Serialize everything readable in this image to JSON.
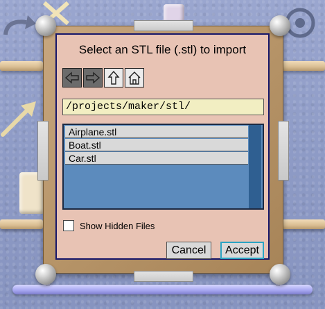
{
  "dialog": {
    "title": "Select an STL file (.stl) to import",
    "nav": {
      "back_icon": "arrow-left-icon",
      "forward_icon": "arrow-right-icon",
      "up_icon": "arrow-up-icon",
      "home_icon": "home-icon"
    },
    "path": "/projects/maker/stl/",
    "files": [
      "Airplane.stl",
      "Boat.stl",
      "Car.stl"
    ],
    "show_hidden_label": "Show Hidden Files",
    "show_hidden_checked": false,
    "cancel_label": "Cancel",
    "accept_label": "Accept"
  },
  "colors": {
    "dialog_bg": "#e8c3b4",
    "dialog_border": "#16166a",
    "path_field_bg": "#f2eec2",
    "file_list_bg": "#5c8bbd",
    "accept_focus": "#2aa4c4"
  }
}
